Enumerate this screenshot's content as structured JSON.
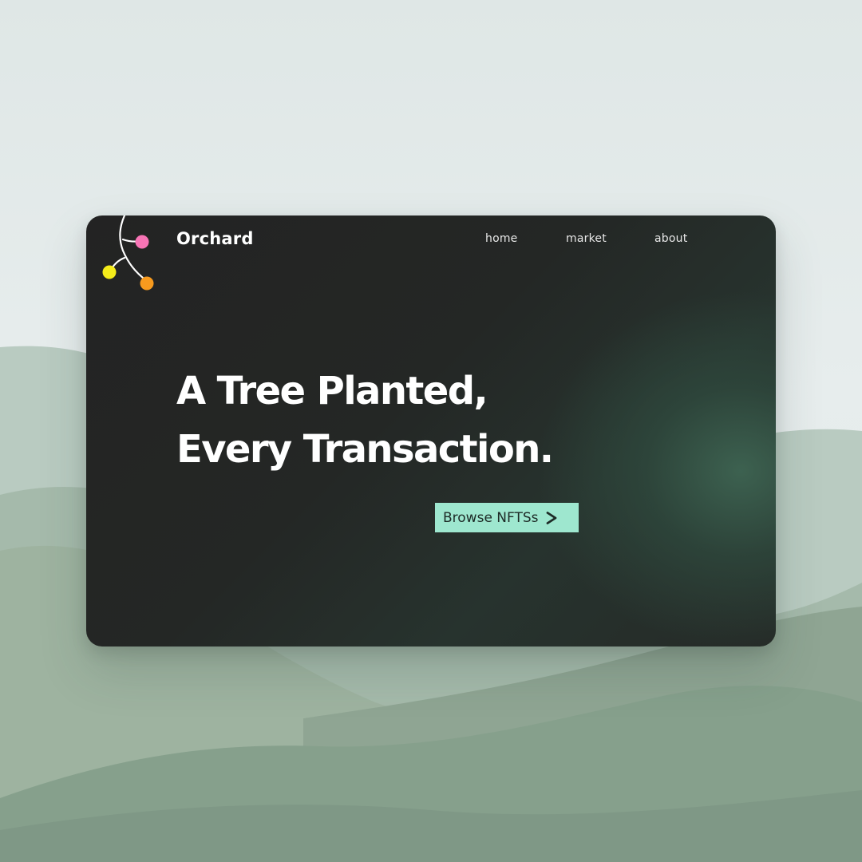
{
  "header": {
    "brand": "Orchard",
    "nav": [
      {
        "label": "home"
      },
      {
        "label": "market"
      },
      {
        "label": "about"
      }
    ]
  },
  "hero": {
    "headline_line1": "A Tree Planted,",
    "headline_line2": "Every Transaction.",
    "cta_label": "Browse NFTSs",
    "cta_icon": "chevron-right-icon"
  },
  "logo": {
    "icon": "branch-with-berries-icon",
    "berry_colors": [
      "#f774b5",
      "#f4ec1a",
      "#f79a1e"
    ]
  },
  "colors": {
    "card_background": "#242424",
    "card_glow": "#3e6452",
    "cta_background": "#9ee7cf",
    "text": "#ffffff",
    "page_background": "#e3eaea",
    "hills": [
      "#b6c8bd",
      "#9fb5a6",
      "#8ea597"
    ]
  }
}
